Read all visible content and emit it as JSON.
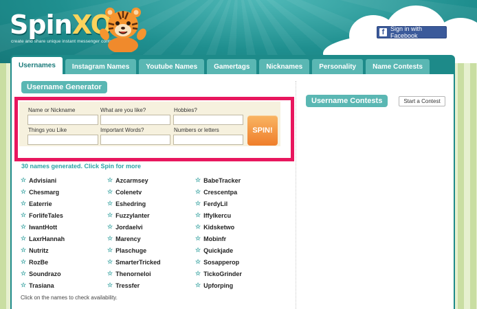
{
  "header": {
    "logo_main": "Spin",
    "logo_accent": "XO",
    "tagline": "create and share unique instant messenger content",
    "facebook_icon": "f",
    "facebook_button": "Sign in with Facebook"
  },
  "nav": {
    "tabs": [
      {
        "label": "Usernames",
        "active": true
      },
      {
        "label": "Instagram Names"
      },
      {
        "label": "Youtube Names"
      },
      {
        "label": "Gamertags"
      },
      {
        "label": "Nicknames"
      },
      {
        "label": "Personality"
      },
      {
        "label": "Name Contests"
      }
    ]
  },
  "generator": {
    "title": "Username Generator",
    "fields": [
      {
        "label": "Name or Nickname",
        "value": ""
      },
      {
        "label": "What are you like?",
        "value": ""
      },
      {
        "label": "Hobbies?",
        "value": ""
      },
      {
        "label": "Things you Like",
        "value": ""
      },
      {
        "label": "Important Words?",
        "value": ""
      },
      {
        "label": "Numbers or letters",
        "value": ""
      }
    ],
    "spin_button": "SPIN!",
    "generated_message": "30 names generated. Click Spin for more",
    "names": [
      [
        "Advisiani",
        "Chesmarg",
        "Eaterrie",
        "ForlifeTales",
        "IwantHott",
        "LaxrHannah",
        "Nutritz",
        "RozBe",
        "Soundrazo",
        "Trasiana"
      ],
      [
        "Azcarmsey",
        "Colenetv",
        "Eshedring",
        "Fuzzylanter",
        "Jordaelvi",
        "Marency",
        "Plaschuge",
        "SmarterTricked",
        "Thenorneloi",
        "Tressfer"
      ],
      [
        "BabeTracker",
        "Crescentpa",
        "FerdyLil",
        "Iffylkercu",
        "Kidsketwo",
        "Mobinfr",
        "Quickjade",
        "Sosapperop",
        "TickoGrinder",
        "Upforping"
      ]
    ],
    "footnote": "Click on the names to check availability."
  },
  "contests": {
    "title": "Username Contests",
    "start_button": "Start a Contest"
  },
  "colors": {
    "teal": "#1d8a89",
    "highlight": "#e8175e",
    "spin": "#ef7e2b"
  }
}
